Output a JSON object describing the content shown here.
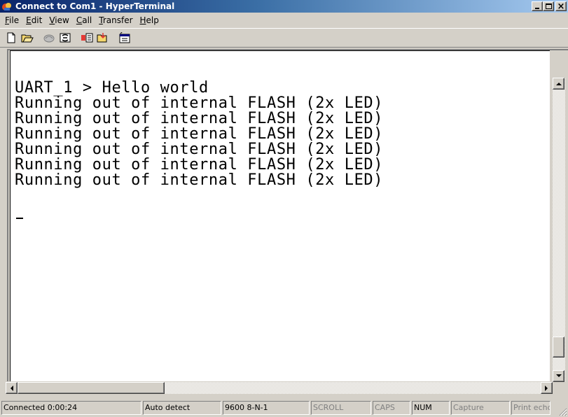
{
  "window": {
    "title": "Connect to Com1 - HyperTerminal",
    "controls": {
      "minimize": "_",
      "maximize": "□",
      "close": "×"
    }
  },
  "menu": [
    "File",
    "Edit",
    "View",
    "Call",
    "Transfer",
    "Help"
  ],
  "menu_mnemonics": [
    "F",
    "E",
    "V",
    "C",
    "T",
    "H"
  ],
  "toolbar": {
    "buttons": [
      "new-icon",
      "open-icon",
      "connect-icon",
      "disconnect-icon",
      "send-icon",
      "receive-icon",
      "properties-icon"
    ]
  },
  "terminal": {
    "lines": [
      "UART_1 > Hello world",
      "Running out of internal FLASH (2x LED)",
      "Running out of internal FLASH (2x LED)",
      "Running out of internal FLASH (2x LED)",
      "Running out of internal FLASH (2x LED)",
      "Running out of internal FLASH (2x LED)",
      "Running out of internal FLASH (2x LED)"
    ],
    "cursor": "_"
  },
  "status": {
    "connected": "Connected 0:00:24",
    "detect": "Auto detect",
    "port_settings": "9600 8-N-1",
    "scroll": "SCROLL",
    "caps": "CAPS",
    "num": "NUM",
    "capture": "Capture",
    "print": "Print echo"
  },
  "colors": {
    "title_start": "#0a246a",
    "title_end": "#a6caf0",
    "face": "#d4d0c8"
  }
}
